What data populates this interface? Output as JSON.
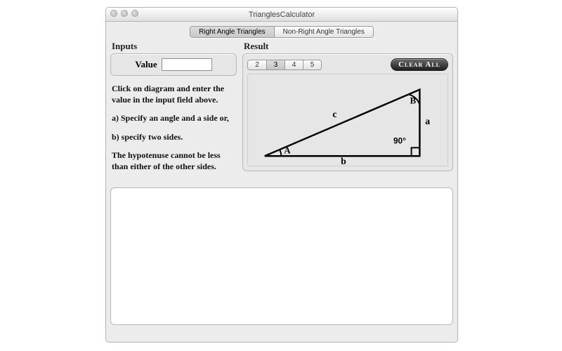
{
  "window": {
    "title": "TrianglesCalculator"
  },
  "tabs": {
    "right": "Right Angle Triangles",
    "nonright": "Non-Right Angle Triangles",
    "active": "right"
  },
  "inputs": {
    "title": "Inputs",
    "value_label": "Value",
    "value": ""
  },
  "instructions": {
    "p1": "Click on diagram and enter the value in the input field above.",
    "p2": "a) Specify an angle and a side or,",
    "p3": "b) specify two sides.",
    "p4": "The hypotenuse cannot be less than either of the other sides."
  },
  "result": {
    "title": "Result",
    "precision_options": {
      "o1": "2",
      "o2": "3",
      "o3": "4",
      "o4": "5",
      "active": "3"
    },
    "clear_label": "Clear All",
    "diagram": {
      "A": "A",
      "B": "B",
      "a": "a",
      "b": "b",
      "c": "c",
      "right_angle": "90°"
    }
  }
}
